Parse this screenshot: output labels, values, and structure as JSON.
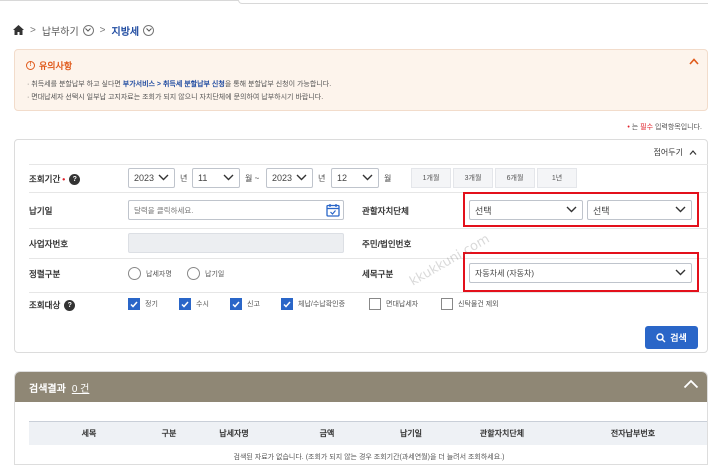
{
  "breadcrumb": {
    "level1": "납부하기",
    "current": "지방세"
  },
  "notice": {
    "title": "유의사항",
    "line1_pre": "· 취득세를 분할납부 하고 싶다면 ",
    "line1_link": "부가서비스 > 취득세 분할납부 신청",
    "line1_post": "을 통해 분할납부 신청이 가능합니다.",
    "line2": "· 면대납세자 선택시 일부납 고지자료는 조회가 되지 않으니 자치단체에 문의하여 납부하시기 바랍니다."
  },
  "required_note": {
    "pre": "는 ",
    "word": "필수",
    "post": " 입력항목입니다."
  },
  "form": {
    "fold_label": "접어두기",
    "period_label": "조회기간",
    "start_year": "2023",
    "start_month": "11",
    "end_year": "2023",
    "end_month": "12",
    "unit_year": "년",
    "unit_month_from": "월 ~",
    "unit_month": "월",
    "period_buttons": [
      "1개월",
      "3개월",
      "6개월",
      "1년"
    ],
    "due_date_label": "납기일",
    "due_date_placeholder": "달력을 클릭하세요.",
    "region_label": "관할자치단체",
    "region_select1": "선택",
    "region_select2": "선택",
    "bizno_label": "사업자번호",
    "regno_label": "주민/법인번호",
    "payment_type_label": "정렬구분",
    "radio1": "납세자명",
    "radio2": "납기일",
    "tax_type_label": "세목구분",
    "tax_type_value": "자동차세 (자동차)",
    "target_label": "조회대상",
    "checks": [
      {
        "label": "정기",
        "checked": true
      },
      {
        "label": "수시",
        "checked": true
      },
      {
        "label": "신고",
        "checked": true
      },
      {
        "label": "체납/수납확인증",
        "checked": true
      },
      {
        "label": "면대납세자",
        "checked": false
      },
      {
        "label": "신탁물건 제외",
        "checked": false
      }
    ],
    "search_button": "검색"
  },
  "watermark": "kkukkuni.com",
  "results": {
    "title": "검색결과",
    "count": "0 건",
    "columns": [
      "세목",
      "구분",
      "납세자명",
      "금액",
      "납기일",
      "관할자치단체",
      "전자납부번호"
    ],
    "empty_text": "검색된 자료가 없습니다. (조회가 되지 않는 경우 조회기간(과세연월)을 더 늘려서 조회하세요.)"
  },
  "colors": {
    "accent": "#2a66c8",
    "highlight": "#e3101b",
    "results_header": "#8f8775",
    "notice_title": "#e05a1b"
  }
}
